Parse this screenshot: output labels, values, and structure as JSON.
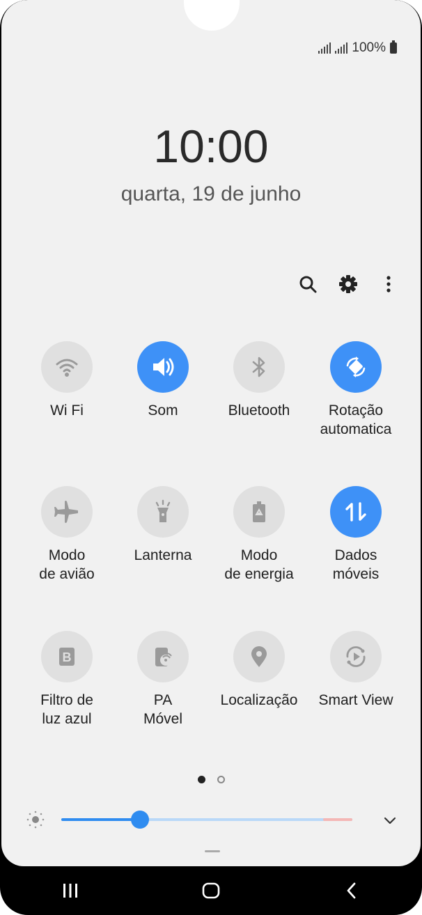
{
  "status_bar": {
    "battery_text": "100%"
  },
  "lock": {
    "time": "10:00",
    "date": "quarta, 19 de junho"
  },
  "toolbar": {
    "search": "search-icon",
    "settings": "gear-icon",
    "more": "more-vert-icon"
  },
  "tiles": [
    {
      "label_1": "Wi Fi",
      "label_2": "",
      "state": "off",
      "icon": "wifi-icon"
    },
    {
      "label_1": "Som",
      "label_2": "",
      "state": "on",
      "icon": "speaker-icon"
    },
    {
      "label_1": "Bluetooth",
      "label_2": "",
      "state": "off",
      "icon": "bluetooth-icon"
    },
    {
      "label_1": "Rotação",
      "label_2": "automatica",
      "state": "on",
      "icon": "auto-rotate-icon"
    },
    {
      "label_1": "Modo",
      "label_2": "de avião",
      "state": "off",
      "icon": "airplane-icon"
    },
    {
      "label_1": "Lanterna",
      "label_2": "",
      "state": "off",
      "icon": "flashlight-icon"
    },
    {
      "label_1": "Modo",
      "label_2": "de energia",
      "state": "off",
      "icon": "power-saving-icon"
    },
    {
      "label_1": "Dados",
      "label_2": "móveis",
      "state": "on",
      "icon": "mobile-data-icon"
    },
    {
      "label_1": "Filtro de",
      "label_2": "luz azul",
      "state": "off",
      "icon": "blue-light-filter-icon"
    },
    {
      "label_1": "PA",
      "label_2": "Móvel",
      "state": "off",
      "icon": "mobile-hotspot-icon"
    },
    {
      "label_1": "Localização",
      "label_2": "",
      "state": "off",
      "icon": "location-icon"
    },
    {
      "label_1": "Smart View",
      "label_2": "",
      "state": "off",
      "icon": "smart-view-icon"
    }
  ],
  "pager": {
    "pages": 2,
    "current": 1
  },
  "brightness": {
    "level": 0.27
  },
  "colors": {
    "accent": "#3e91f7",
    "tile_off": "#e0e0e0",
    "panel_bg": "#f1f1f1"
  },
  "nav": {
    "recents": "recents-icon",
    "home": "home-icon",
    "back": "back-icon"
  }
}
